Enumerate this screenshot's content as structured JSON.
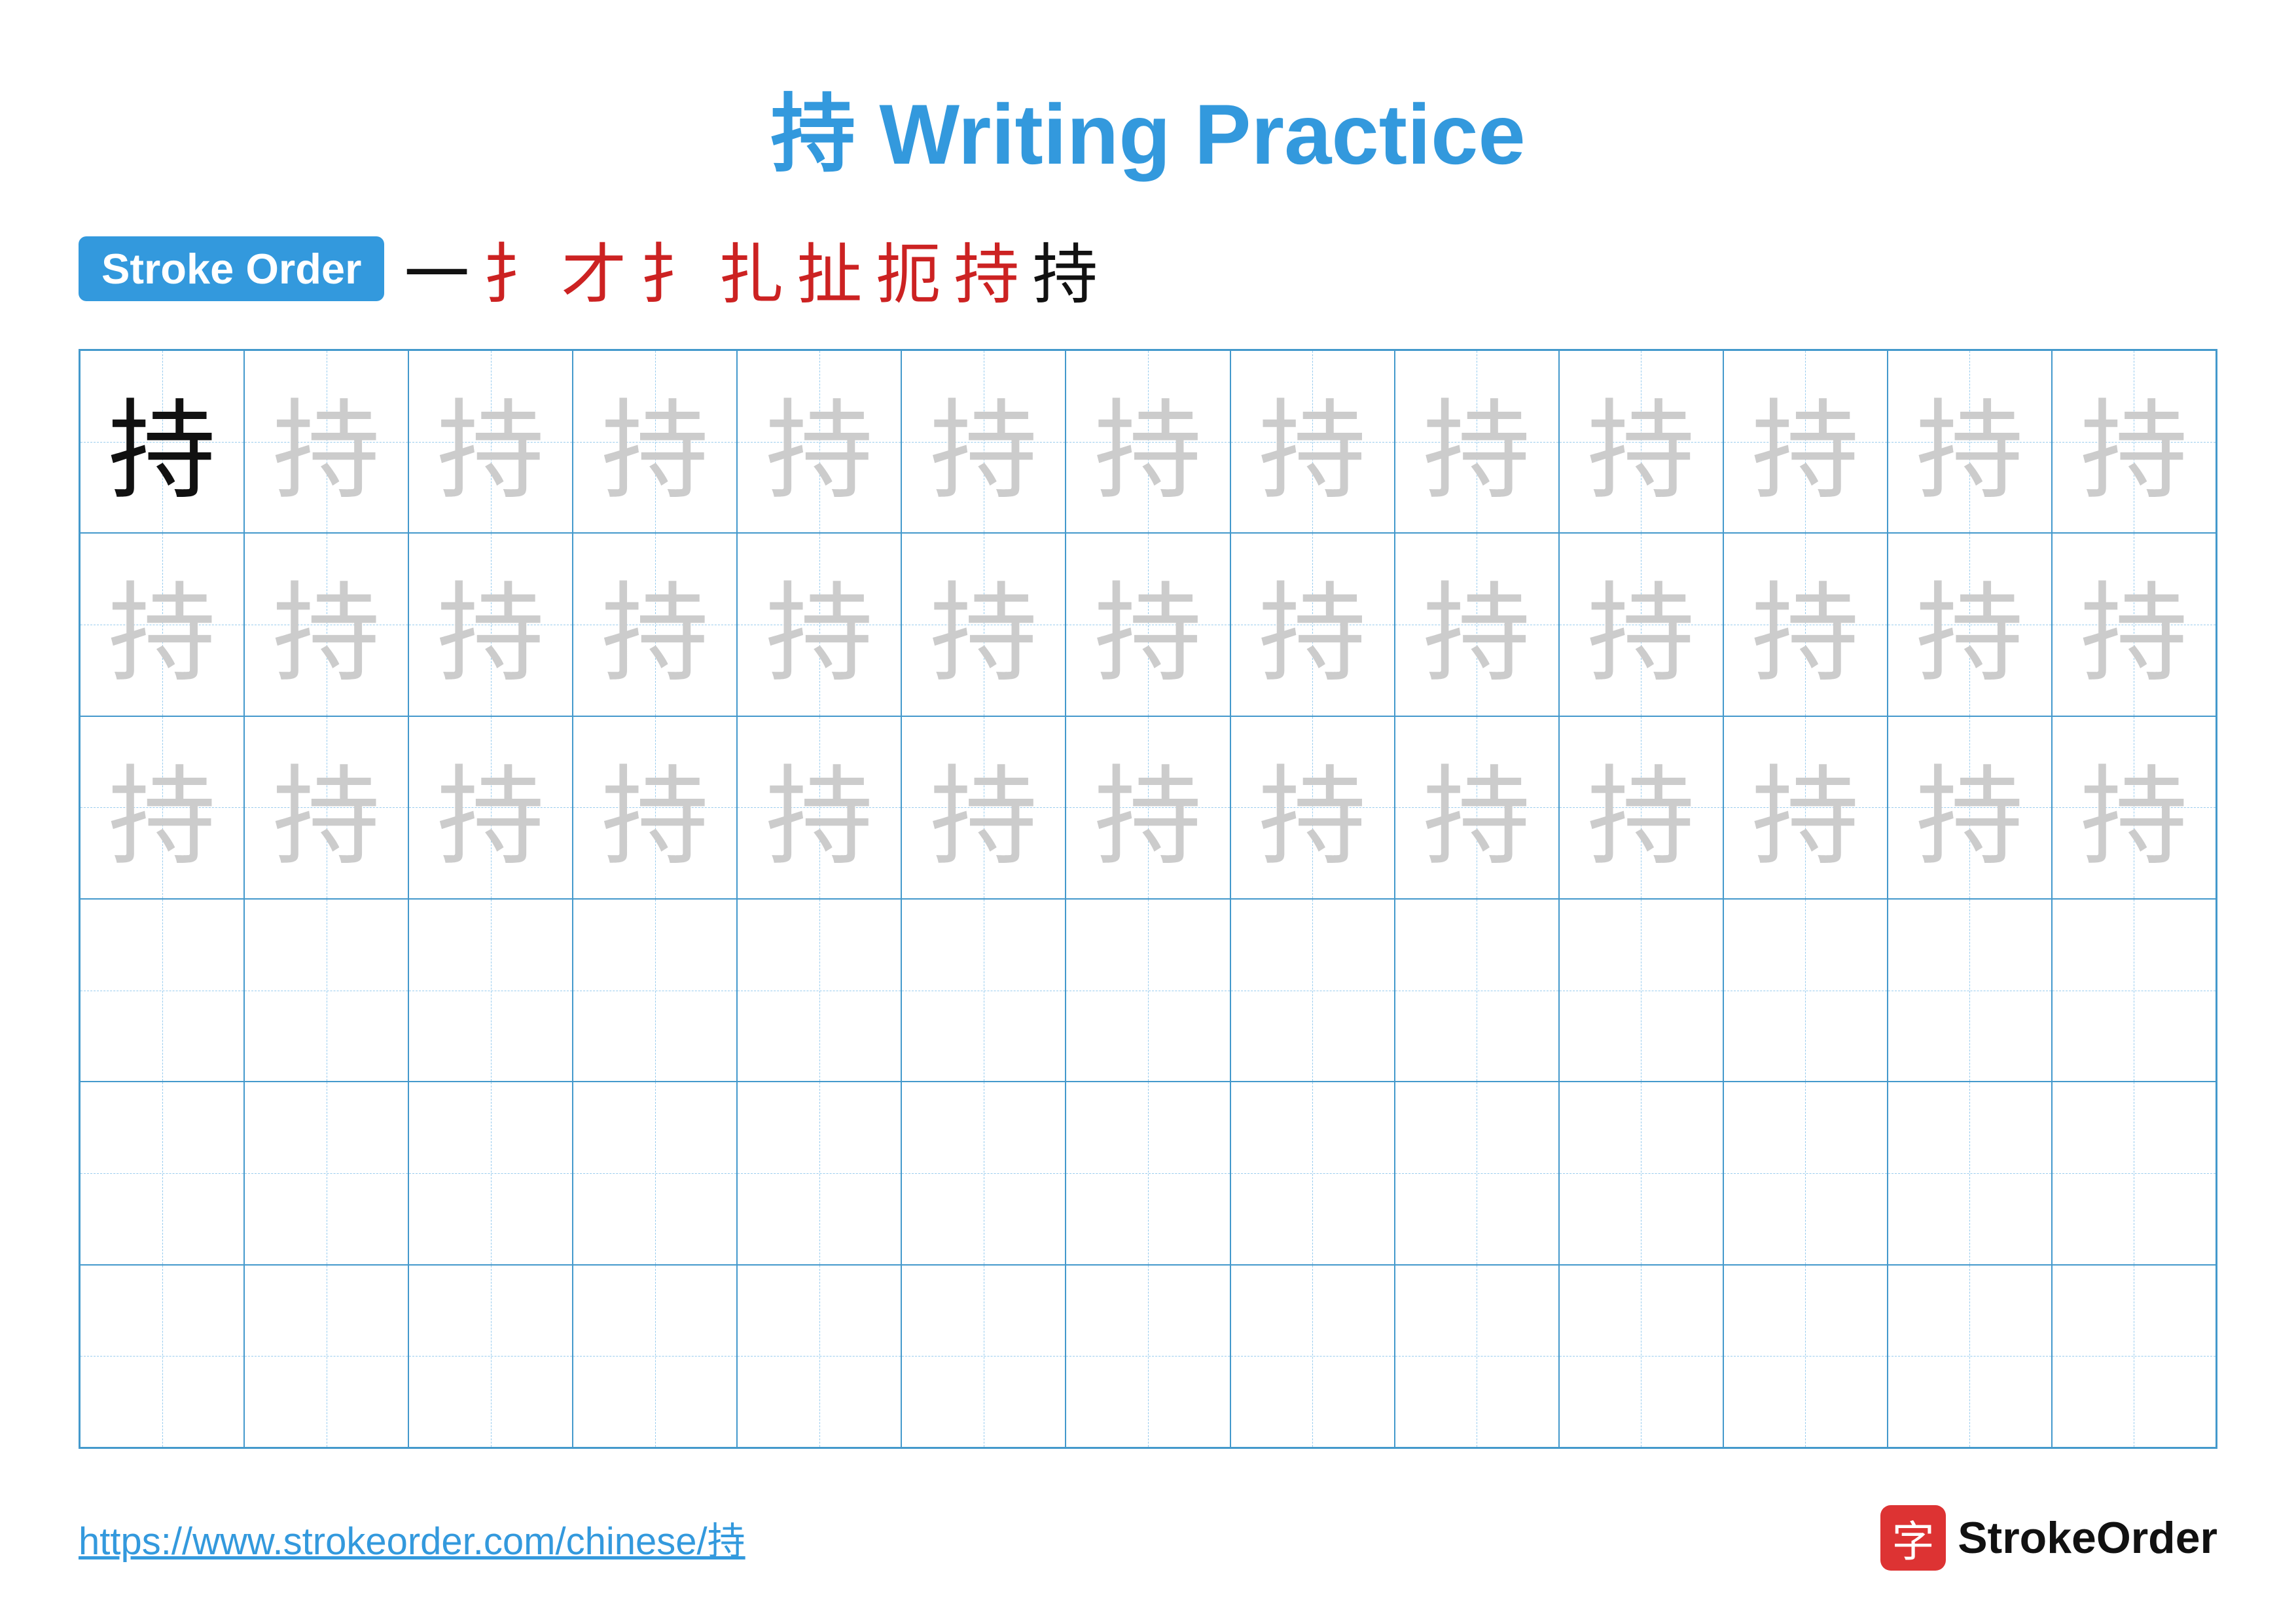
{
  "title": "持 Writing Practice",
  "stroke_order_label": "Stroke Order",
  "stroke_chars": [
    "一",
    "扌",
    "才",
    "扌",
    "扎",
    "扯",
    "扼",
    "持",
    "持"
  ],
  "stroke_chars_colors": [
    "black",
    "red",
    "red",
    "red",
    "red",
    "red",
    "red",
    "red",
    "black"
  ],
  "grid": {
    "cols": 13,
    "rows": 6,
    "char": "持",
    "first_cell_style": "black",
    "row1_style": "light",
    "row2_style": "light",
    "row3_style": "light",
    "row4_style": "empty",
    "row5_style": "empty",
    "row6_style": "empty"
  },
  "footer": {
    "url": "https://www.strokeorder.com/chinese/持",
    "logo_char": "字",
    "logo_text": "StrokeOrder"
  }
}
